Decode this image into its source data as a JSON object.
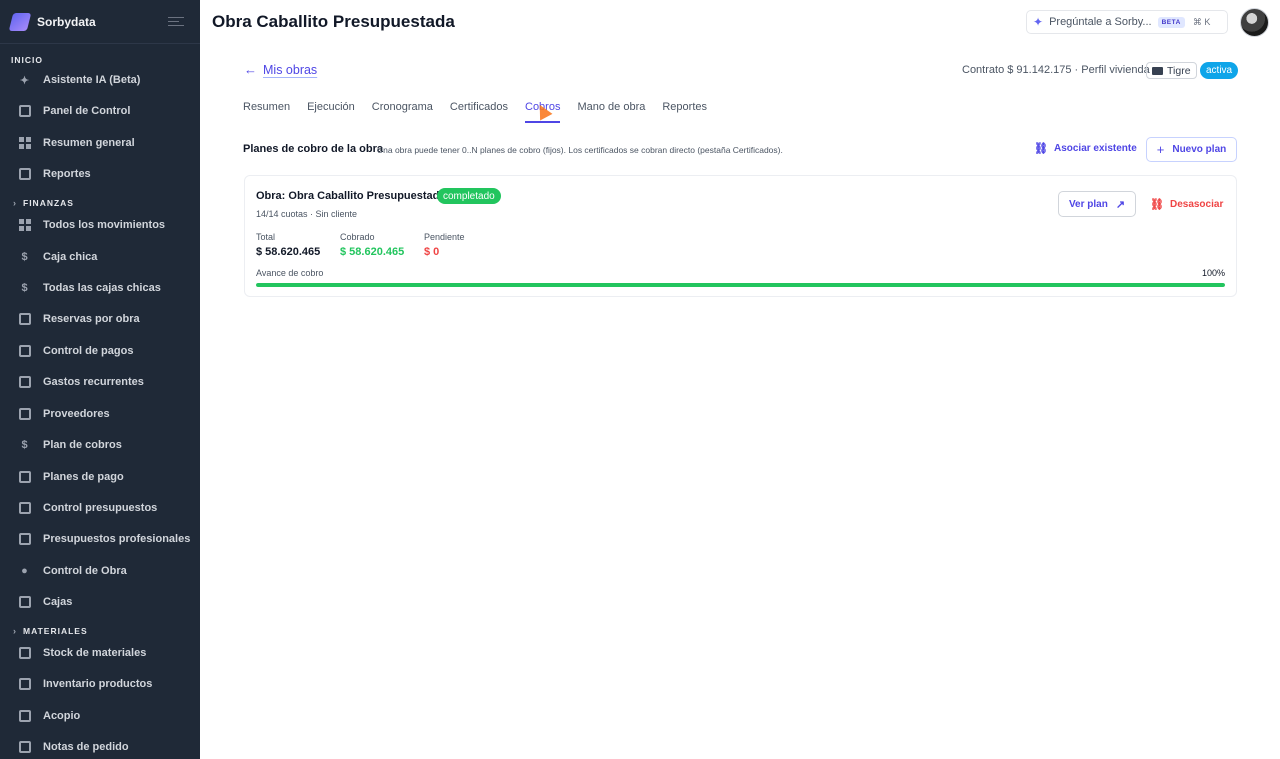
{
  "app": {
    "name": "Sorbydata"
  },
  "sidebar": {
    "sections": [
      {
        "label": "Inicio"
      },
      {
        "label": "Finanzas"
      },
      {
        "label": "Materiales"
      }
    ],
    "items": [
      {
        "label": "Asistente IA (Beta)",
        "icon": "sparkle-icon"
      },
      {
        "label": "Panel de Control",
        "icon": "building-icon"
      },
      {
        "label": "Resumen general",
        "icon": "grid-icon"
      },
      {
        "label": "Reportes",
        "icon": "chart-icon"
      },
      {
        "label": "Todos los movimientos",
        "icon": "grid-icon"
      },
      {
        "label": "Caja chica",
        "icon": "dollar-icon"
      },
      {
        "label": "Todas las cajas chicas",
        "icon": "dollar-icon"
      },
      {
        "label": "Reservas por obra",
        "icon": "wallet-icon"
      },
      {
        "label": "Control de pagos",
        "icon": "cash-icon"
      },
      {
        "label": "Gastos recurrentes",
        "icon": "cash-icon"
      },
      {
        "label": "Proveedores",
        "icon": "store-icon"
      },
      {
        "label": "Plan de cobros",
        "icon": "dollar-icon"
      },
      {
        "label": "Planes de pago",
        "icon": "payments-icon"
      },
      {
        "label": "Control presupuestos",
        "icon": "doc-icon"
      },
      {
        "label": "Presupuestos profesionales",
        "icon": "doc-icon"
      },
      {
        "label": "Control de Obra",
        "icon": "engineer-icon"
      },
      {
        "label": "Cajas",
        "icon": "wallet-icon"
      },
      {
        "label": "Stock de materiales",
        "icon": "inventory-icon"
      },
      {
        "label": "Inventario productos",
        "icon": "inventory-icon"
      },
      {
        "label": "Acopio",
        "icon": "inventory-icon"
      },
      {
        "label": "Notas de pedido",
        "icon": "inventory-icon"
      }
    ]
  },
  "header": {
    "title": "Obra Caballito Presupuestada",
    "ask_label": "Pregúntale a Sorby...",
    "ask_badge": "BETA",
    "shortcut": "⌘ K"
  },
  "project": {
    "back_label": "Mis obras",
    "contract": "Contrato $ 91.142.175 · Perfil vivienda",
    "city": "Tigre",
    "status": "activa"
  },
  "tabs": [
    {
      "label": "Resumen"
    },
    {
      "label": "Ejecución"
    },
    {
      "label": "Cronograma"
    },
    {
      "label": "Certificados"
    },
    {
      "label": "Cobros",
      "active": true
    },
    {
      "label": "Mano de obra"
    },
    {
      "label": "Reportes"
    }
  ],
  "section": {
    "title": "Planes de cobro de la obra",
    "description": "Una obra puede tener 0..N planes de cobro (fijos). Los certificados se cobran directo (pestaña Certificados).",
    "link_label": "Asociar existente",
    "new_label": "Nuevo plan"
  },
  "plan": {
    "title": "Obra: Obra Caballito Presupuestada",
    "status": "completado",
    "subtitle": "14/14 cuotas · Sin cliente",
    "total_label": "Total",
    "total_value": "$ 58.620.465",
    "cobrado_label": "Cobrado",
    "cobrado_value": "$ 58.620.465",
    "pendiente_label": "Pendiente",
    "pendiente_value": "$ 0",
    "progress_label": "Avance de cobro",
    "progress_pct": "100%",
    "progress_value": 1.0,
    "view_label": "Ver plan",
    "unlink_label": "Desasociar"
  },
  "colors": {
    "accent": "#4f46e5",
    "success": "#22c55e",
    "danger": "#ef4444",
    "info": "#0ea5e9"
  }
}
